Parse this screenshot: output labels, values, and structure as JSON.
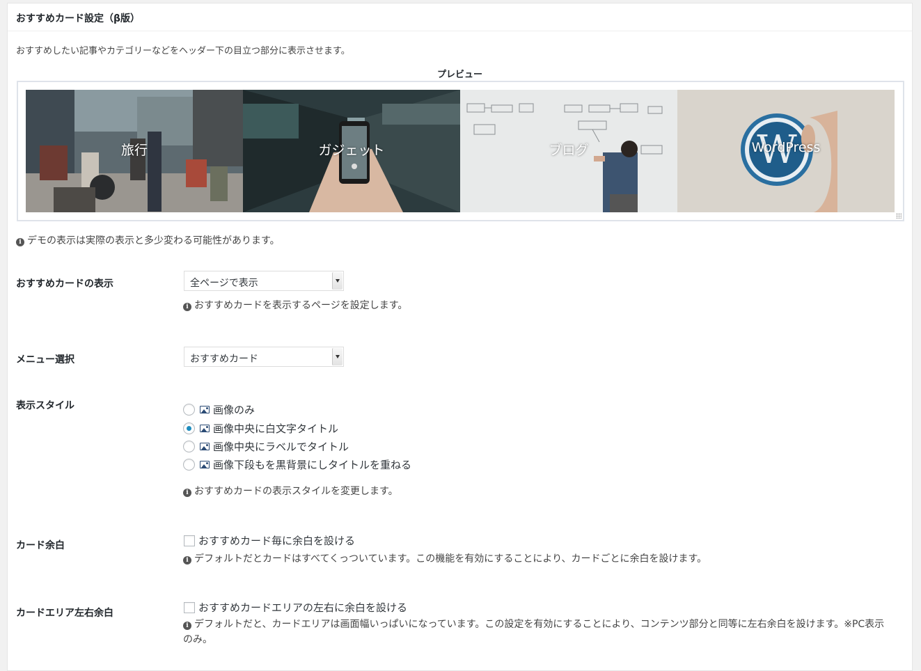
{
  "panel": {
    "title": "おすすめカード設定（β版）",
    "intro": "おすすめしたい記事やカテゴリーなどをヘッダー下の目立つ部分に表示させます。"
  },
  "preview": {
    "label": "プレビュー",
    "cards": [
      {
        "title": "旅行"
      },
      {
        "title": "ガジェット"
      },
      {
        "title": "ブログ"
      },
      {
        "title": "WordPress"
      }
    ],
    "note": "デモの表示は実際の表示と多少変わる可能性があります。"
  },
  "settings": {
    "display": {
      "label": "おすすめカードの表示",
      "selected": "全ページで表示",
      "help": "おすすめカードを表示するページを設定します。"
    },
    "menu": {
      "label": "メニュー選択",
      "selected": "おすすめカード"
    },
    "style": {
      "label": "表示スタイル",
      "options": [
        {
          "label": "画像のみ",
          "checked": false
        },
        {
          "label": "画像中央に白文字タイトル",
          "checked": true
        },
        {
          "label": "画像中央にラベルでタイトル",
          "checked": false
        },
        {
          "label": "画像下段もを黒背景にしタイトルを重ねる",
          "checked": false
        }
      ],
      "help": "おすすめカードの表示スタイルを変更します。"
    },
    "margin": {
      "label": "カード余白",
      "checkbox_label": "おすすめカード毎に余白を設ける",
      "checked": false,
      "help": "デフォルトだとカードはすべてくっついています。この機能を有効にすることにより、カードごとに余白を設けます。"
    },
    "side_margin": {
      "label": "カードエリア左右余白",
      "checkbox_label": "おすすめカードエリアの左右に余白を設ける",
      "checked": false,
      "help": "デフォルトだと、カードエリアは画面幅いっぱいになっています。この設定を有効にすることにより、コンテンツ部分と同等に左右余白を設けます。※PC表示のみ。"
    }
  },
  "icons": {
    "info": "info-circle-icon",
    "image": "image-icon"
  },
  "colors": {
    "radio_checked": "#1e8cbe",
    "image_icon": "#2a4a74"
  }
}
